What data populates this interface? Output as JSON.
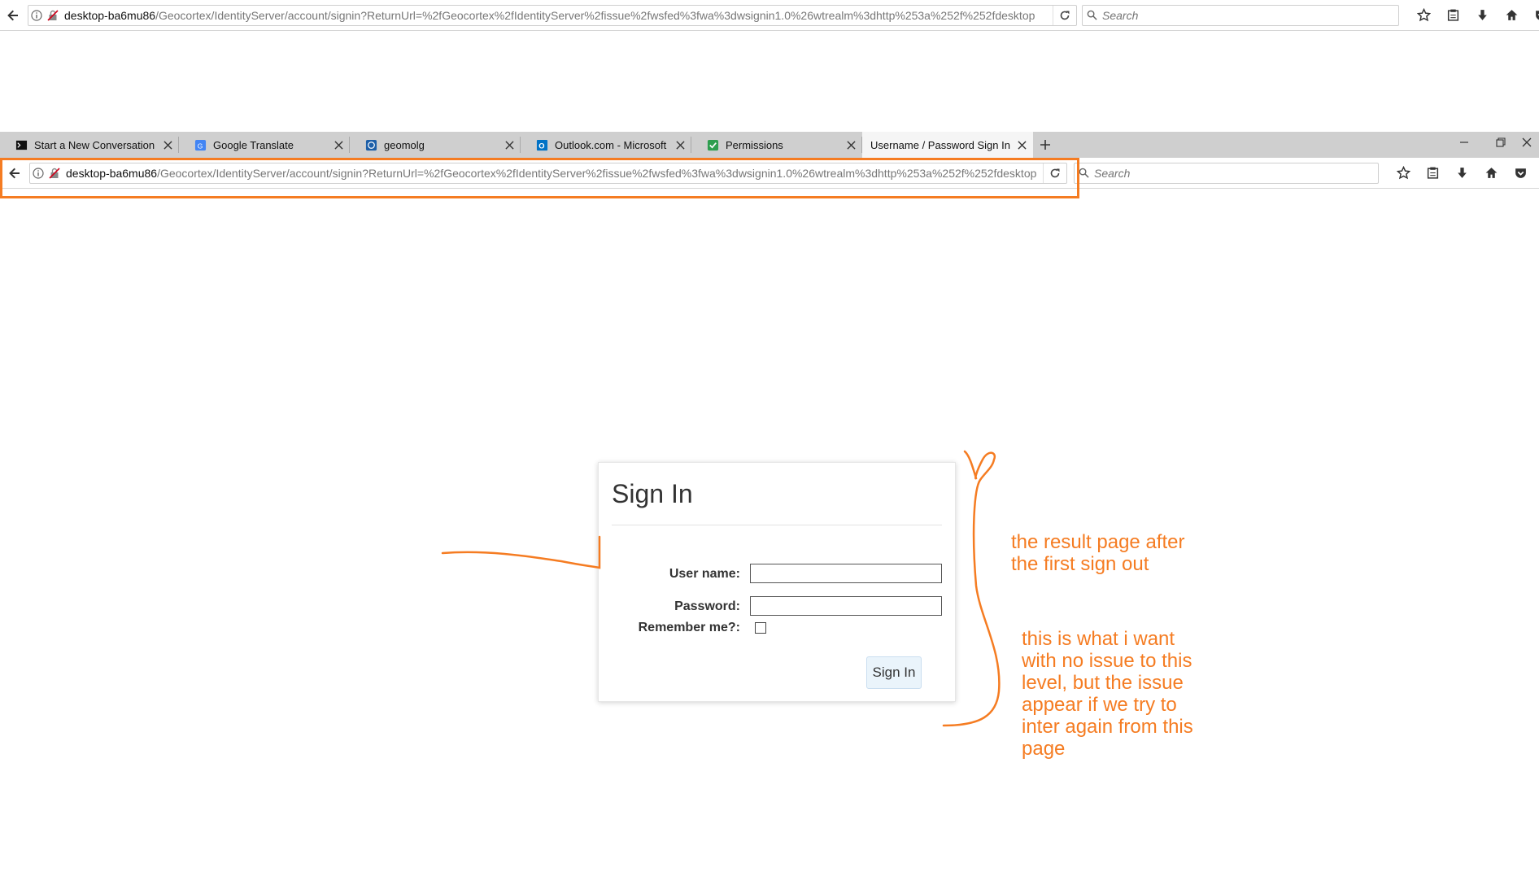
{
  "top_browser": {
    "url_host": "desktop-ba6mu86",
    "url_path": "/Geocortex/IdentityServer/account/signin?ReturnUrl=%2fGeocortex%2fIdentityServer%2fissue%2fwsfed%3fwa%3dwsignin1.0%26wtrealm%3dhttp%253a%252f%252fdesktop",
    "search_placeholder": "Search"
  },
  "tabs": [
    {
      "label": "Start a New Conversation | C",
      "favicon": "terminal-icon"
    },
    {
      "label": "Google Translate",
      "favicon": "translate-icon"
    },
    {
      "label": "geomolg",
      "favicon": "site-icon"
    },
    {
      "label": "Outlook.com - Microsoft fre",
      "favicon": "outlook-icon"
    },
    {
      "label": "Permissions",
      "favicon": "permissions-icon"
    },
    {
      "label": "Username / Password Sign In",
      "favicon": "none",
      "active": true
    }
  ],
  "browser": {
    "url_host": "desktop-ba6mu86",
    "url_path": "/Geocortex/IdentityServer/account/signin?ReturnUrl=%2fGeocortex%2fIdentityServer%2fissue%2fwsfed%3fwa%3dwsignin1.0%26wtrealm%3dhttp%253a%252f%252fdesktop",
    "search_placeholder": "Search"
  },
  "signin": {
    "title": "Sign In",
    "username_label": "User name:",
    "password_label": "Password:",
    "remember_label": "Remember me?:",
    "button_label": "Sign In",
    "username_value": "",
    "password_value": "",
    "remember_checked": false
  },
  "annotations": {
    "note1": [
      "the result page after",
      "the first sign out"
    ],
    "note2": [
      "this is what i want",
      "with no issue to this",
      "level, but the issue",
      "appear if we try to",
      "inter again from this",
      "page"
    ]
  },
  "colors": {
    "annotation": "#f57c22",
    "tab_strip": "#cfcfcf",
    "button_bg": "#eaf4fb"
  }
}
